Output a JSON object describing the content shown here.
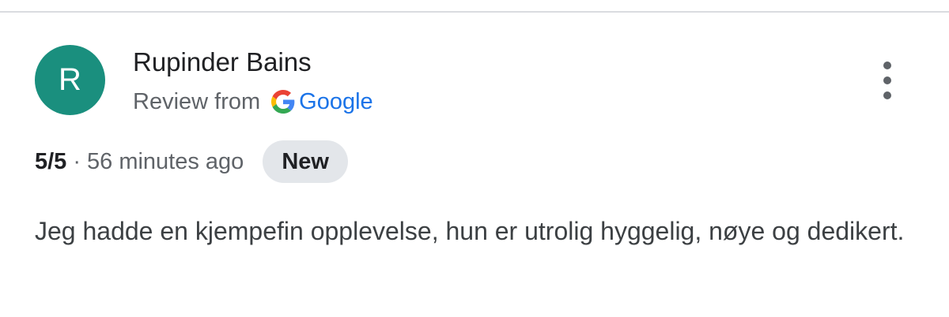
{
  "reviewer": {
    "initial": "R",
    "name": "Rupinder Bains",
    "avatar_color": "#1a8f7e"
  },
  "source": {
    "label": "Review from",
    "name": "Google",
    "icon": "google-g-icon"
  },
  "review": {
    "rating": "5/5",
    "separator": "·",
    "timestamp": "56 minutes ago",
    "badge": "New",
    "text": "Jeg hadde en kjempefin opplevelse, hun er utrolig hyggelig, nøye og dedikert."
  },
  "menu": {
    "icon": "more-vertical-icon"
  },
  "colors": {
    "badge_bg": "#e3e6ea",
    "link_blue": "#1a73e8",
    "divider": "#dadce0"
  }
}
